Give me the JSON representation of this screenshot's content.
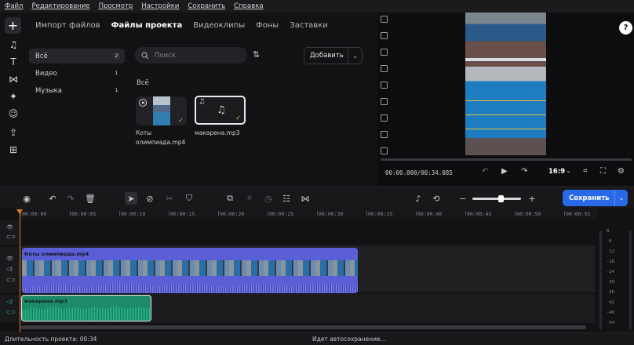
{
  "menu": [
    "Файл",
    "Редактирование",
    "Просмотр",
    "Настройки",
    "Сохранить",
    "Справка"
  ],
  "rail_icons": [
    "add-icon",
    "music-note-icon",
    "text-icon",
    "transition-icon",
    "effects-sparkle-icon",
    "sticker-smile-icon",
    "export-icon",
    "templates-grid-icon"
  ],
  "media": {
    "tabs": [
      {
        "label": "Импорт файлов",
        "active": false
      },
      {
        "label": "Файлы проекта",
        "active": true
      },
      {
        "label": "Видеоклипы",
        "active": false
      },
      {
        "label": "Фоны",
        "active": false
      },
      {
        "label": "Заставки",
        "active": false
      }
    ],
    "categories": [
      {
        "label": "Всё",
        "count": "2",
        "active": true
      },
      {
        "label": "Видео",
        "count": "1",
        "active": false
      },
      {
        "label": "Музыка",
        "count": "1",
        "active": false
      }
    ],
    "search_placeholder": "Поиск",
    "add_label": "Добавить",
    "section_title": "Всё",
    "files": [
      {
        "name_line1": "Коты",
        "name_line2": "олимпиада.mp4",
        "type": "video"
      },
      {
        "name_line1": "макарена.mp3",
        "name_line2": "",
        "type": "audio"
      }
    ]
  },
  "preview": {
    "timecode": "00:00.000/00:34.085",
    "ratio": "16:9",
    "help": "?"
  },
  "toolbar": {
    "save_label": "Сохранить"
  },
  "ruler": [
    "00:00:00",
    "00:00:05",
    "00:00:10",
    "00:00:15",
    "00:00:20",
    "00:00:25",
    "00:00:30",
    "00:00:35",
    "00:00:40",
    "00:00:45",
    "00:00:50",
    "00:00:55"
  ],
  "timeline": {
    "video_clip": "Коты олимпиада.mp4",
    "audio_clip": "макарена.mp3"
  },
  "meter_labels": [
    "0",
    "-6",
    "-12",
    "-18",
    "-24",
    "-30",
    "-36",
    "-42",
    "-48",
    "-54"
  ],
  "status": {
    "duration": "Длительность проекта: 00:34",
    "autosave": "Идет автосохранение..."
  },
  "colors": {
    "accent": "#2a6ae8",
    "video_clip": "#5a5fd6",
    "audio_clip": "#1f8a6a",
    "playhead": "#e07a20"
  }
}
